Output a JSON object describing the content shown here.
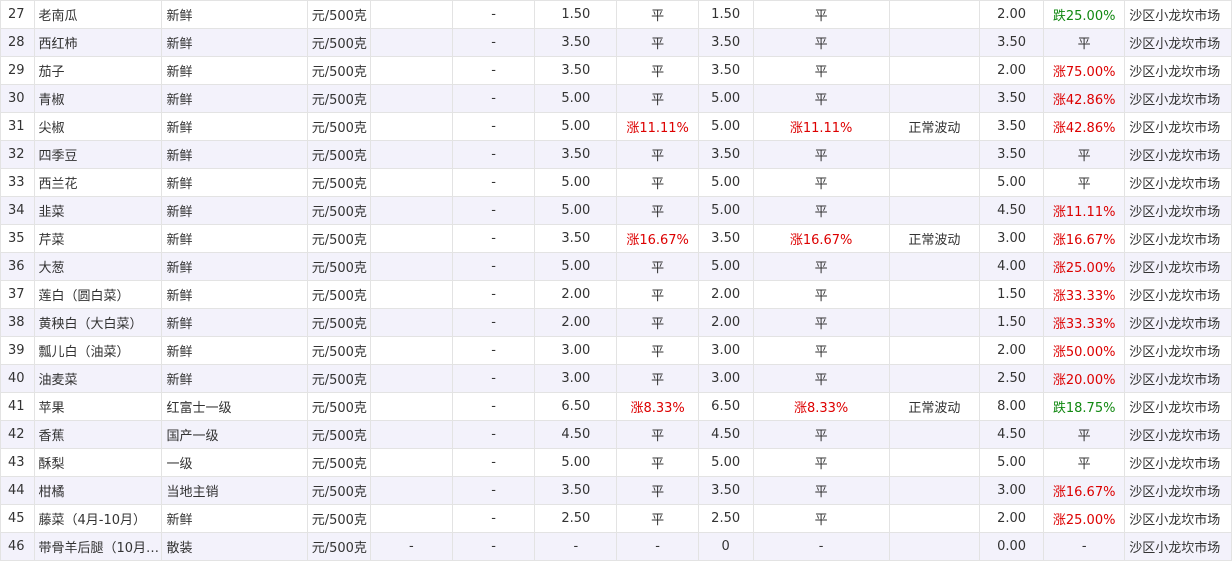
{
  "colors": {
    "up": "#dd0000",
    "down": "#118811",
    "flat": "#333333",
    "stripe": "#f3f2fb",
    "border": "#e3e3e3"
  },
  "rows": [
    {
      "idx": "27",
      "name": "老南瓜",
      "spec": "新鲜",
      "unit": "元/500克",
      "c5": "",
      "c6": "-",
      "p1": "1.50",
      "ch1": "平",
      "p2": "1.50",
      "ch2": "平",
      "note": "",
      "p3": "2.00",
      "ch3": "跌25.00%",
      "market": "沙区小龙坎市场"
    },
    {
      "idx": "28",
      "name": "西红柿",
      "spec": "新鲜",
      "unit": "元/500克",
      "c5": "",
      "c6": "-",
      "p1": "3.50",
      "ch1": "平",
      "p2": "3.50",
      "ch2": "平",
      "note": "",
      "p3": "3.50",
      "ch3": "平",
      "market": "沙区小龙坎市场"
    },
    {
      "idx": "29",
      "name": "茄子",
      "spec": "新鲜",
      "unit": "元/500克",
      "c5": "",
      "c6": "-",
      "p1": "3.50",
      "ch1": "平",
      "p2": "3.50",
      "ch2": "平",
      "note": "",
      "p3": "2.00",
      "ch3": "涨75.00%",
      "market": "沙区小龙坎市场"
    },
    {
      "idx": "30",
      "name": "青椒",
      "spec": "新鲜",
      "unit": "元/500克",
      "c5": "",
      "c6": "-",
      "p1": "5.00",
      "ch1": "平",
      "p2": "5.00",
      "ch2": "平",
      "note": "",
      "p3": "3.50",
      "ch3": "涨42.86%",
      "market": "沙区小龙坎市场"
    },
    {
      "idx": "31",
      "name": "尖椒",
      "spec": "新鲜",
      "unit": "元/500克",
      "c5": "",
      "c6": "-",
      "p1": "5.00",
      "ch1": "涨11.11%",
      "p2": "5.00",
      "ch2": "涨11.11%",
      "note": "正常波动",
      "p3": "3.50",
      "ch3": "涨42.86%",
      "market": "沙区小龙坎市场"
    },
    {
      "idx": "32",
      "name": "四季豆",
      "spec": "新鲜",
      "unit": "元/500克",
      "c5": "",
      "c6": "-",
      "p1": "3.50",
      "ch1": "平",
      "p2": "3.50",
      "ch2": "平",
      "note": "",
      "p3": "3.50",
      "ch3": "平",
      "market": "沙区小龙坎市场"
    },
    {
      "idx": "33",
      "name": "西兰花",
      "spec": "新鲜",
      "unit": "元/500克",
      "c5": "",
      "c6": "-",
      "p1": "5.00",
      "ch1": "平",
      "p2": "5.00",
      "ch2": "平",
      "note": "",
      "p3": "5.00",
      "ch3": "平",
      "market": "沙区小龙坎市场"
    },
    {
      "idx": "34",
      "name": "韭菜",
      "spec": "新鲜",
      "unit": "元/500克",
      "c5": "",
      "c6": "-",
      "p1": "5.00",
      "ch1": "平",
      "p2": "5.00",
      "ch2": "平",
      "note": "",
      "p3": "4.50",
      "ch3": "涨11.11%",
      "market": "沙区小龙坎市场"
    },
    {
      "idx": "35",
      "name": "芹菜",
      "spec": "新鲜",
      "unit": "元/500克",
      "c5": "",
      "c6": "-",
      "p1": "3.50",
      "ch1": "涨16.67%",
      "p2": "3.50",
      "ch2": "涨16.67%",
      "note": "正常波动",
      "p3": "3.00",
      "ch3": "涨16.67%",
      "market": "沙区小龙坎市场"
    },
    {
      "idx": "36",
      "name": "大葱",
      "spec": "新鲜",
      "unit": "元/500克",
      "c5": "",
      "c6": "-",
      "p1": "5.00",
      "ch1": "平",
      "p2": "5.00",
      "ch2": "平",
      "note": "",
      "p3": "4.00",
      "ch3": "涨25.00%",
      "market": "沙区小龙坎市场"
    },
    {
      "idx": "37",
      "name": "莲白（圆白菜）",
      "spec": "新鲜",
      "unit": "元/500克",
      "c5": "",
      "c6": "-",
      "p1": "2.00",
      "ch1": "平",
      "p2": "2.00",
      "ch2": "平",
      "note": "",
      "p3": "1.50",
      "ch3": "涨33.33%",
      "market": "沙区小龙坎市场"
    },
    {
      "idx": "38",
      "name": "黄秧白（大白菜）",
      "spec": "新鲜",
      "unit": "元/500克",
      "c5": "",
      "c6": "-",
      "p1": "2.00",
      "ch1": "平",
      "p2": "2.00",
      "ch2": "平",
      "note": "",
      "p3": "1.50",
      "ch3": "涨33.33%",
      "market": "沙区小龙坎市场"
    },
    {
      "idx": "39",
      "name": "瓢儿白（油菜）",
      "spec": "新鲜",
      "unit": "元/500克",
      "c5": "",
      "c6": "-",
      "p1": "3.00",
      "ch1": "平",
      "p2": "3.00",
      "ch2": "平",
      "note": "",
      "p3": "2.00",
      "ch3": "涨50.00%",
      "market": "沙区小龙坎市场"
    },
    {
      "idx": "40",
      "name": "油麦菜",
      "spec": "新鲜",
      "unit": "元/500克",
      "c5": "",
      "c6": "-",
      "p1": "3.00",
      "ch1": "平",
      "p2": "3.00",
      "ch2": "平",
      "note": "",
      "p3": "2.50",
      "ch3": "涨20.00%",
      "market": "沙区小龙坎市场"
    },
    {
      "idx": "41",
      "name": "苹果",
      "spec": "红富士一级",
      "unit": "元/500克",
      "c5": "",
      "c6": "-",
      "p1": "6.50",
      "ch1": "涨8.33%",
      "p2": "6.50",
      "ch2": "涨8.33%",
      "note": "正常波动",
      "p3": "8.00",
      "ch3": "跌18.75%",
      "market": "沙区小龙坎市场"
    },
    {
      "idx": "42",
      "name": "香蕉",
      "spec": "国产一级",
      "unit": "元/500克",
      "c5": "",
      "c6": "-",
      "p1": "4.50",
      "ch1": "平",
      "p2": "4.50",
      "ch2": "平",
      "note": "",
      "p3": "4.50",
      "ch3": "平",
      "market": "沙区小龙坎市场"
    },
    {
      "idx": "43",
      "name": "酥梨",
      "spec": "一级",
      "unit": "元/500克",
      "c5": "",
      "c6": "-",
      "p1": "5.00",
      "ch1": "平",
      "p2": "5.00",
      "ch2": "平",
      "note": "",
      "p3": "5.00",
      "ch3": "平",
      "market": "沙区小龙坎市场"
    },
    {
      "idx": "44",
      "name": "柑橘",
      "spec": "当地主销",
      "unit": "元/500克",
      "c5": "",
      "c6": "-",
      "p1": "3.50",
      "ch1": "平",
      "p2": "3.50",
      "ch2": "平",
      "note": "",
      "p3": "3.00",
      "ch3": "涨16.67%",
      "market": "沙区小龙坎市场"
    },
    {
      "idx": "45",
      "name": "藤菜（4月-10月）",
      "spec": "新鲜",
      "unit": "元/500克",
      "c5": "",
      "c6": "-",
      "p1": "2.50",
      "ch1": "平",
      "p2": "2.50",
      "ch2": "平",
      "note": "",
      "p3": "2.00",
      "ch3": "涨25.00%",
      "market": "沙区小龙坎市场"
    },
    {
      "idx": "46",
      "name": "带骨羊后腿（10月…",
      "spec": "散装",
      "unit": "元/500克",
      "c5": "-",
      "c6": "-",
      "p1": "-",
      "ch1": "-",
      "p2": "0",
      "ch2": "-",
      "note": "",
      "p3": "0.00",
      "ch3": "-",
      "market": "沙区小龙坎市场"
    }
  ]
}
